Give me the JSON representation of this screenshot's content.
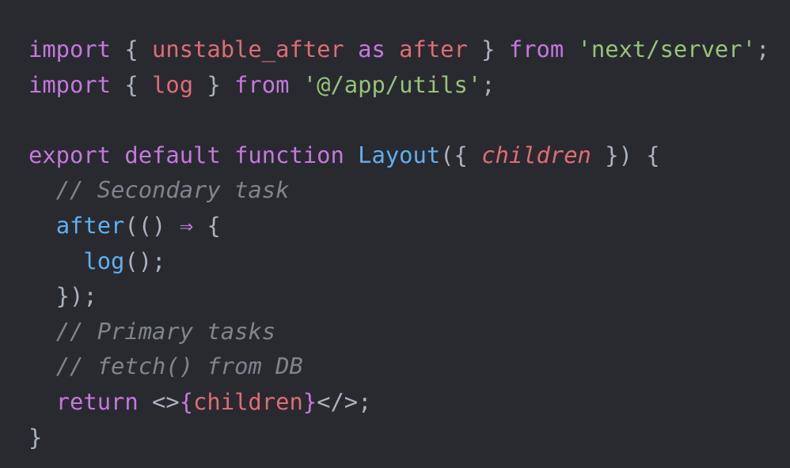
{
  "theme": {
    "background": "#282a30",
    "keyword": "#c678dd",
    "variable": "#e06c75",
    "string": "#98c379",
    "function": "#61afef",
    "punctuation": "#abb2bf",
    "comment": "#7f848e"
  },
  "code": {
    "lines": [
      [
        [
          "kw",
          "import"
        ],
        [
          "pun",
          " { "
        ],
        [
          "var",
          "unstable_after"
        ],
        [
          "pun",
          " "
        ],
        [
          "kw",
          "as"
        ],
        [
          "pun",
          " "
        ],
        [
          "var",
          "after"
        ],
        [
          "pun",
          " } "
        ],
        [
          "kw",
          "from"
        ],
        [
          "pun",
          " "
        ],
        [
          "str",
          "'next/server'"
        ],
        [
          "pun",
          ";"
        ]
      ],
      [
        [
          "kw",
          "import"
        ],
        [
          "pun",
          " { "
        ],
        [
          "var",
          "log"
        ],
        [
          "pun",
          " } "
        ],
        [
          "kw",
          "from"
        ],
        [
          "pun",
          " "
        ],
        [
          "str",
          "'@/app/utils'"
        ],
        [
          "pun",
          ";"
        ]
      ],
      [],
      [
        [
          "kw",
          "export"
        ],
        [
          "pun",
          " "
        ],
        [
          "kw",
          "default"
        ],
        [
          "pun",
          " "
        ],
        [
          "kw",
          "function"
        ],
        [
          "pun",
          " "
        ],
        [
          "fn",
          "Layout"
        ],
        [
          "pun",
          "({ "
        ],
        [
          "param",
          "children"
        ],
        [
          "pun",
          " }) {"
        ]
      ],
      [
        [
          "pun",
          "  "
        ],
        [
          "cm",
          "// Secondary task"
        ]
      ],
      [
        [
          "pun",
          "  "
        ],
        [
          "fn",
          "after"
        ],
        [
          "pun",
          "(() "
        ],
        [
          "kw",
          "⇒"
        ],
        [
          "pun",
          " {"
        ]
      ],
      [
        [
          "pun",
          "    "
        ],
        [
          "fn",
          "log"
        ],
        [
          "pun",
          "();"
        ]
      ],
      [
        [
          "pun",
          "  });"
        ]
      ],
      [
        [
          "pun",
          "  "
        ],
        [
          "cm",
          "// Primary tasks"
        ]
      ],
      [
        [
          "pun",
          "  "
        ],
        [
          "cm",
          "// fetch() from DB"
        ]
      ],
      [
        [
          "pun",
          "  "
        ],
        [
          "kw",
          "return"
        ],
        [
          "pun",
          " <>"
        ],
        [
          "jsx",
          "{"
        ],
        [
          "var",
          "children"
        ],
        [
          "jsx",
          "}"
        ],
        [
          "pun",
          "</>;"
        ]
      ],
      [
        [
          "pun",
          "}"
        ]
      ]
    ]
  }
}
